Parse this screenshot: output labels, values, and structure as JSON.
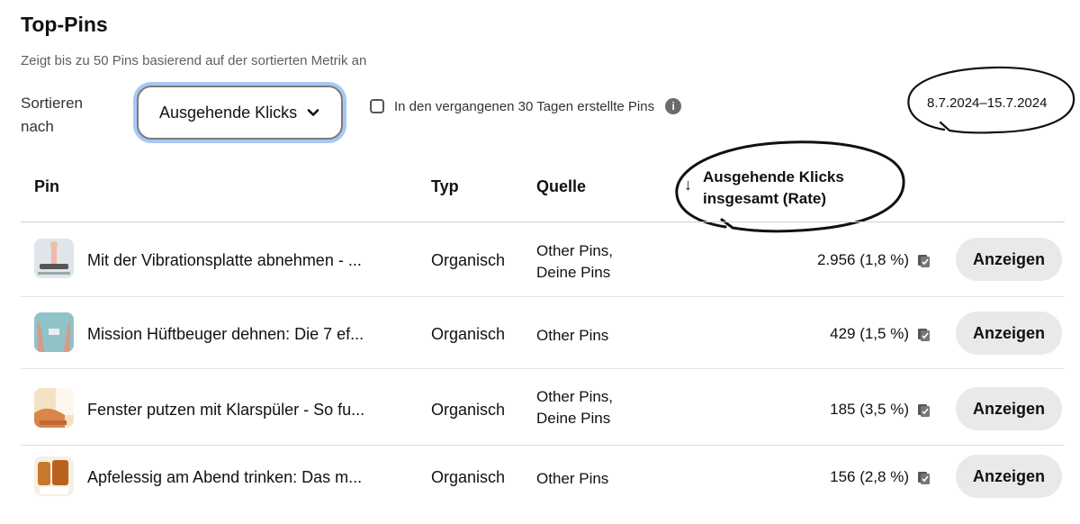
{
  "header": {
    "title": "Top-Pins",
    "subtitle": "Zeigt bis zu 50 Pins basierend auf der sortierten Metrik an"
  },
  "controls": {
    "sort_label": "Sortieren nach",
    "sort_value": "Ausgehende Klicks",
    "checkbox_label": "In den vergangenen 30 Tagen erstellte Pins",
    "checkbox_checked": false,
    "info_icon": "info-icon",
    "date_range": "8.7.2024–15.7.2024"
  },
  "table": {
    "columns": {
      "pin": "Pin",
      "type": "Typ",
      "source": "Quelle",
      "metric": "Ausgehende Klicks insgesamt (Rate)"
    },
    "sort_direction_icon": "arrow-down-icon",
    "rows": [
      {
        "title": "Mit der Vibrationsplatte abnehmen - ...",
        "type": "Organisch",
        "source_line1": "Other Pins,",
        "source_line2": "Deine Pins",
        "metric": "2.956 (1,8 %)",
        "button": "Anzeigen",
        "thumb_color": "#cfd8dc"
      },
      {
        "title": "Mission Hüftbeuger dehnen: Die 7 ef...",
        "type": "Organisch",
        "source_line1": "Other Pins",
        "source_line2": "",
        "metric": "429 (1,5 %)",
        "button": "Anzeigen",
        "thumb_color": "#8fc3c8"
      },
      {
        "title": "Fenster putzen mit Klarspüler - So fu...",
        "type": "Organisch",
        "source_line1": "Other Pins,",
        "source_line2": "Deine Pins",
        "metric": "185 (3,5 %)",
        "button": "Anzeigen",
        "thumb_color": "#e8b77a"
      },
      {
        "title": "Apfelessig am Abend trinken: Das m...",
        "type": "Organisch",
        "source_line1": "Other Pins",
        "source_line2": "",
        "metric": "156 (2,8 %)",
        "button": "Anzeigen",
        "thumb_color": "#c98a3a"
      }
    ]
  }
}
